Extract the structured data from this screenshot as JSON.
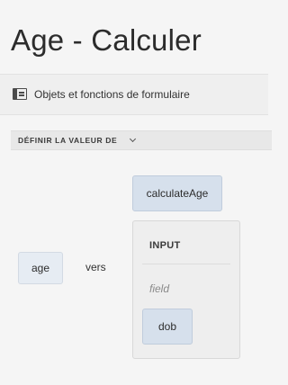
{
  "page": {
    "title": "Age - Calculer"
  },
  "toolbar": {
    "icon": "form-objects-icon",
    "label": "Objets et fonctions de formulaire"
  },
  "rule": {
    "section_label": "DÉFINIR LA VALEUR DE",
    "target_field": "age",
    "connector": "vers",
    "function_name": "calculateAge",
    "input_panel": {
      "title": "INPUT",
      "field_placeholder": "field",
      "field_value": "dob"
    }
  },
  "colors": {
    "background": "#f5f5f5",
    "token_fill": "#d6e0ec",
    "token_light_fill": "#e6ecf3",
    "section_header": "#e8e8e8"
  }
}
